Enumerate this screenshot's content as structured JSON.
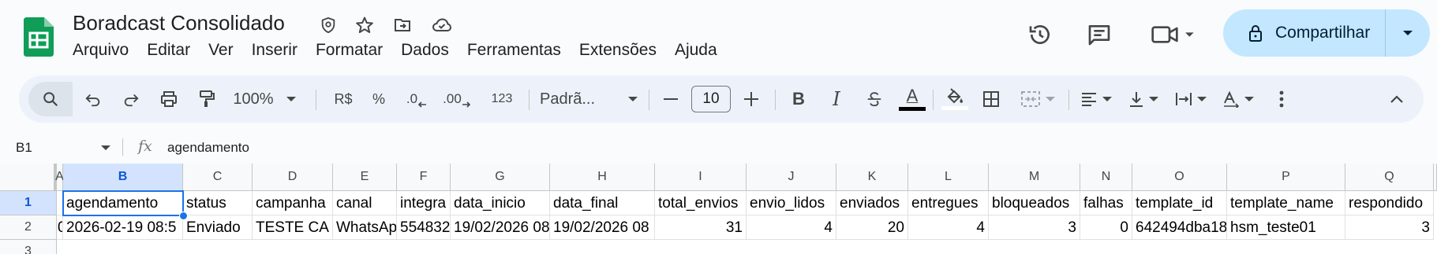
{
  "app": {
    "title": "Boradcast Consolidado",
    "menu": [
      "Arquivo",
      "Editar",
      "Ver",
      "Inserir",
      "Formatar",
      "Dados",
      "Ferramentas",
      "Extensões",
      "Ajuda"
    ],
    "share_label": "Compartilhar"
  },
  "toolbar": {
    "zoom": "100%",
    "currency": "R$",
    "percent": "%",
    "dec_decrease": ".0",
    "dec_increase": ".00",
    "number_format": "123",
    "font": "Padrã...",
    "font_size": "10",
    "bold": "B",
    "italic": "I",
    "text_color_letter": "A",
    "underline_color": "#000000"
  },
  "formula_bar": {
    "cell_ref": "B1",
    "fx": "fx",
    "content": "agendamento"
  },
  "sheet": {
    "columns": [
      "A",
      "B",
      "C",
      "D",
      "E",
      "F",
      "G",
      "H",
      "I",
      "J",
      "K",
      "L",
      "M",
      "N",
      "O",
      "P",
      "Q"
    ],
    "rows": [
      "1",
      "2",
      "3"
    ],
    "row1": [
      "",
      "agendamento",
      "status",
      "campanha",
      "canal",
      "integra",
      "data_inicio",
      "data_final",
      "total_envios",
      "envio_lidos",
      "enviados",
      "entregues",
      "bloqueados",
      "falhas",
      "template_id",
      "template_name",
      "respondido"
    ],
    "row2": [
      "0",
      "2026-02-19 08:5",
      "Enviado",
      "TESTE CA",
      "WhatsAp",
      "554832",
      "19/02/2026 08",
      "19/02/2026 08",
      "31",
      "4",
      "20",
      "4",
      "3",
      "0",
      "642494dba18",
      "hsm_teste01",
      "3"
    ]
  },
  "colors": {
    "accent": "#1a73e8",
    "share_bg": "#c2e7ff",
    "toolbar_bg": "#edf2fa",
    "logo_green": "#0f9d58"
  }
}
